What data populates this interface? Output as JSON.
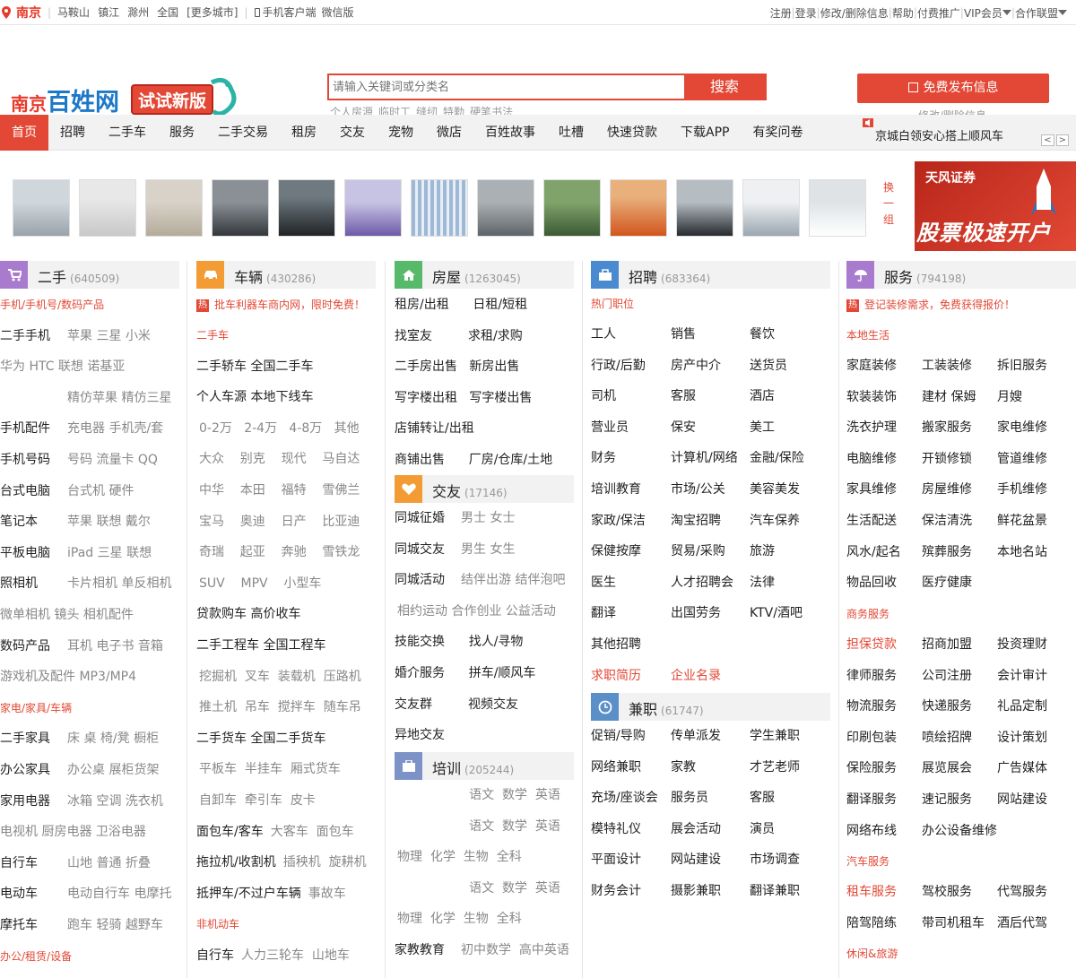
{
  "topbar": {
    "city": "南京",
    "nearby": [
      "马鞍山",
      "镇江",
      "滁州",
      "全国"
    ],
    "more": "[更多城市]",
    "mobile": "手机客户端",
    "weixin": "微信版",
    "links": [
      "注册",
      "登录",
      "修改/删除信息",
      "帮助",
      "付费推广",
      "VIP会员",
      "合作联盟"
    ]
  },
  "header": {
    "logo_city": "南京",
    "logo_name": "百姓网",
    "try_new": "试试新版",
    "search_placeholder": "请输入关键词或分类名",
    "search_btn": "搜索",
    "hotwords": [
      "个人房源",
      "临时工",
      "缝纫",
      "特勤",
      "硬笔书法"
    ],
    "publish": "免费发布信息",
    "edit": "修改/删除信息"
  },
  "nav": {
    "items": [
      "首页",
      "招聘",
      "二手车",
      "服务",
      "二手交易",
      "租房",
      "交友",
      "宠物",
      "微店",
      "百姓故事",
      "吐槽",
      "快速贷款",
      "下载APP",
      "有奖问卷"
    ],
    "ticker": "京城白领安心搭上顺风车"
  },
  "photos": {
    "swap": "换一组",
    "ad_brand": "天风证券",
    "ad_slogan": "股票极速开户"
  },
  "colors": {
    "accent": "#e24835",
    "purple": "#a87bcf",
    "orange": "#f39c35",
    "green": "#57b96a",
    "blue": "#4a8ad0",
    "gray": "#7d93c8"
  },
  "col1": {
    "title": "二手",
    "count": "(640509)",
    "rows": [
      {
        "sub": "手机/手机号/数码产品"
      },
      {
        "a": "二手手机",
        "b": "苹果  三星  小米"
      },
      {
        "b": "华为  HTC  联想  诺基亚"
      },
      {
        "b": "精仿苹果  精仿三星"
      },
      {
        "a": "手机配件",
        "b": "充电器  手机壳/套"
      },
      {
        "a": "手机号码",
        "b": "号码  流量卡  QQ"
      },
      {
        "a": "台式电脑",
        "b": "台式机  硬件"
      },
      {
        "a": "笔记本",
        "b": "苹果  联想  戴尔"
      },
      {
        "a": "平板电脑",
        "b": "iPad  三星  联想"
      },
      {
        "a": "照相机",
        "b": "卡片相机  单反相机"
      },
      {
        "b": "微单相机  镜头  相机配件"
      },
      {
        "a": "数码产品",
        "b": "耳机  电子书  音箱"
      },
      {
        "b": "游戏机及配件  MP3/MP4"
      },
      {
        "sub": "家电/家具/车辆"
      },
      {
        "a": "二手家具",
        "b": "床  桌  椅/凳  橱柜"
      },
      {
        "a": "办公家具",
        "b": "办公桌  展柜货架"
      },
      {
        "a": "家用电器",
        "b": "冰箱  空调  洗衣机"
      },
      {
        "b": "电视机  厨房电器  卫浴电器"
      },
      {
        "a": "自行车",
        "b": "山地  普通  折叠"
      },
      {
        "a": "电动车",
        "b": "电动自行车  电摩托"
      },
      {
        "a": "摩托车",
        "b": "跑车  轻骑  越野车"
      },
      {
        "sub": "办公/租赁/设备"
      }
    ]
  },
  "col2": {
    "title": "车辆",
    "count": "(430286)",
    "ad": "批车利器车商内网，限时免费！",
    "rows": [
      {
        "sub": "二手车"
      },
      {
        "a": "二手轿车  全国二手车"
      },
      {
        "a": "个人车源  本地下线车"
      },
      {
        "b": "0-2万   2-4万   4-8万   其他"
      },
      {
        "b": "大众    别克    现代    马自达"
      },
      {
        "b": "中华    本田    福特    雪佛兰"
      },
      {
        "b": "宝马    奥迪    日产    比亚迪"
      },
      {
        "b": "奇瑞    起亚    奔驰    雪铁龙"
      },
      {
        "b": "SUV    MPV    小型车"
      },
      {
        "a": "贷款购车  高价收车"
      },
      {
        "a": "二手工程车  全国工程车"
      },
      {
        "b": "挖掘机  叉车  装载机  压路机"
      },
      {
        "b": "推土机  吊车  搅拌车  随车吊"
      },
      {
        "a": "二手货车  全国二手货车"
      },
      {
        "b": "平板车  半挂车  厢式货车"
      },
      {
        "b": "自卸车  牵引车  皮卡"
      },
      {
        "a": "面包车/客车",
        "b": "大客车  面包车"
      },
      {
        "a": "拖拉机/收割机",
        "b": "插秧机  旋耕机"
      },
      {
        "a": "抵押车/不过户车辆",
        "b": "事故车"
      },
      {
        "sub": "非机动车"
      },
      {
        "a": "自行车",
        "b": "人力三轮车  山地车"
      }
    ]
  },
  "col3": {
    "title": "房屋",
    "count": "(1263045)",
    "rows": [
      {
        "a": "租房/出租      日租/短租"
      },
      {
        "a": "找室友         求租/求购"
      },
      {
        "a": "二手房出售   新房出售"
      },
      {
        "a": "写字楼出租   写字楼出售"
      },
      {
        "a": "店铺转让/出租"
      },
      {
        "a": "商铺出售      厂房/仓库/土地"
      }
    ],
    "title2": "交友",
    "count2": "(17146)",
    "rows2": [
      {
        "a": "同城征婚",
        "b": "男士  女士"
      },
      {
        "a": "同城交友",
        "b": "男生  女生"
      },
      {
        "a": "同城活动",
        "b": "结伴出游  结伴泡吧"
      },
      {
        "b": "相约运动  合作创业  公益活动"
      },
      {
        "a": "技能交换      找人/寻物"
      },
      {
        "a": "婚介服务      拼车/顺风车"
      },
      {
        "a": "交友群         视频交友"
      },
      {
        "a": "异地交友"
      }
    ],
    "title3": "培训",
    "count3": "(205244)",
    "rows3": [
      {
        "b": "                  语文  数学  英语"
      },
      {
        "b": "                  语文  数学  英语"
      },
      {
        "b": "物理  化学  生物  全科"
      },
      {
        "b": "                  语文  数学  英语"
      },
      {
        "b": "物理  化学  生物  全科"
      },
      {
        "a": "家教教育",
        "b": "初中数学  高中英语"
      }
    ]
  },
  "col4": {
    "title": "招聘",
    "count": "(683364)",
    "hot": "热门职位",
    "rows": [
      [
        "工人",
        "销售",
        "餐饮"
      ],
      [
        "行政/后勤",
        "房产中介",
        "送货员"
      ],
      [
        "司机",
        "客服",
        "酒店"
      ],
      [
        "营业员",
        "保安",
        "美工"
      ],
      [
        "财务",
        "计算机/网络",
        "金融/保险"
      ],
      [
        "培训教育",
        "市场/公关",
        "美容美发"
      ],
      [
        "家政/保洁",
        "淘宝招聘",
        "汽车保养"
      ],
      [
        "保健按摩",
        "贸易/采购",
        "旅游"
      ],
      [
        "医生",
        "人才招聘会",
        "法律"
      ],
      [
        "翻译",
        "出国劳务",
        "KTV/酒吧"
      ],
      [
        "其他招聘",
        "",
        ""
      ]
    ],
    "resume": "求职简历",
    "company": "企业名录",
    "title2": "兼职",
    "count2": "(61747)",
    "rows2": [
      [
        "促销/导购",
        "传单派发",
        "学生兼职"
      ],
      [
        "网络兼职",
        "家教",
        "才艺老师"
      ],
      [
        "充场/座谈会",
        "服务员",
        "客服"
      ],
      [
        "模特礼仪",
        "展会活动",
        "演员"
      ],
      [
        "平面设计",
        "网站建设",
        "市场调查"
      ],
      [
        "财务会计",
        "摄影兼职",
        "翻译兼职"
      ]
    ]
  },
  "col5": {
    "title": "服务",
    "count": "(794198)",
    "ad": "登记装修需求，免费获得报价！",
    "sub1": "本地生活",
    "rows": [
      [
        "家庭装修",
        "工装装修",
        "拆旧服务"
      ],
      [
        "软装装饰",
        "建材  保姆",
        "月嫂"
      ],
      [
        "洗衣护理",
        "搬家服务",
        "家电维修"
      ],
      [
        "电脑维修",
        "开锁修锁",
        "管道维修"
      ],
      [
        "家具维修",
        "房屋维修",
        "手机维修"
      ],
      [
        "生活配送",
        "保洁清洗",
        "鲜花盆景"
      ],
      [
        "风水/起名",
        "殡葬服务",
        "本地名站"
      ],
      [
        "物品回收",
        "医疗健康",
        ""
      ]
    ],
    "sub2": "商务服务",
    "rows2": [
      [
        "担保贷款",
        "招商加盟",
        "投资理财"
      ],
      [
        "律师服务",
        "公司注册",
        "会计审计"
      ],
      [
        "物流服务",
        "快递服务",
        "礼品定制"
      ],
      [
        "印刷包装",
        "喷绘招牌",
        "设计策划"
      ],
      [
        "保险服务",
        "展览展会",
        "广告媒体"
      ],
      [
        "翻译服务",
        "速记服务",
        "网站建设"
      ],
      [
        "网络布线",
        "办公设备维修",
        ""
      ]
    ],
    "sub3": "汽车服务",
    "rows3": [
      [
        "租车服务",
        "驾校服务",
        "代驾服务"
      ],
      [
        "陪驾陪练",
        "带司机租车",
        "酒后代驾"
      ]
    ],
    "sub4": "休闲&旅游"
  }
}
